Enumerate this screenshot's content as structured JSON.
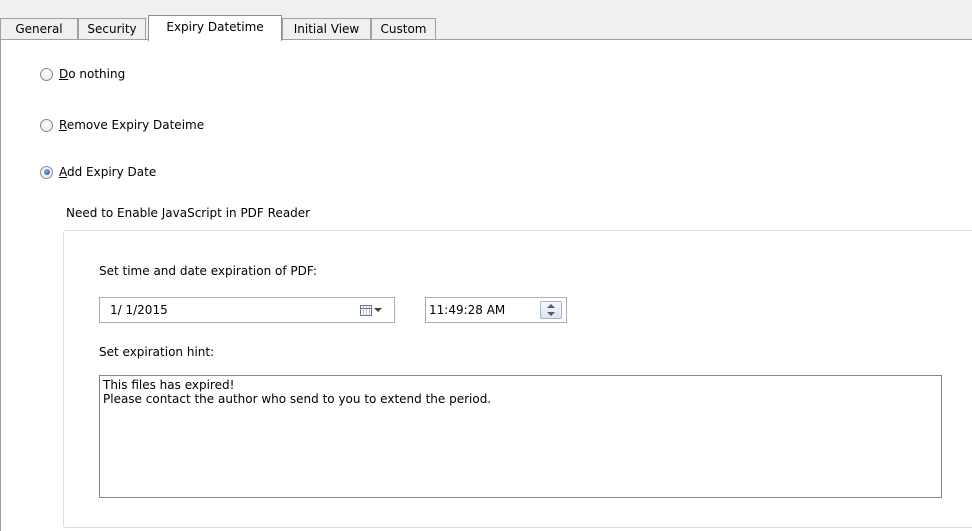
{
  "tabs": [
    {
      "label": "General",
      "active": false
    },
    {
      "label": "Security",
      "active": false
    },
    {
      "label": "Expiry Datetime",
      "active": true
    },
    {
      "label": "Initial View",
      "active": false
    },
    {
      "label": "Custom",
      "active": false
    }
  ],
  "options": [
    {
      "mnemonic": "D",
      "rest": "o nothing",
      "checked": false
    },
    {
      "mnemonic": "R",
      "rest": "emove Expiry Dateime",
      "checked": false
    },
    {
      "mnemonic": "A",
      "rest": "dd Expiry Date",
      "checked": true
    }
  ],
  "note": "Need to Enable JavaScript in PDF Reader",
  "expiration": {
    "set_label": "Set time and date expiration of PDF:",
    "date_value": "1/  1/2015",
    "time_value": "11:49:28 AM",
    "hint_label": "Set expiration hint:",
    "hint_text": "This files has expired!\nPlease contact the author who send to you to extend the period."
  }
}
